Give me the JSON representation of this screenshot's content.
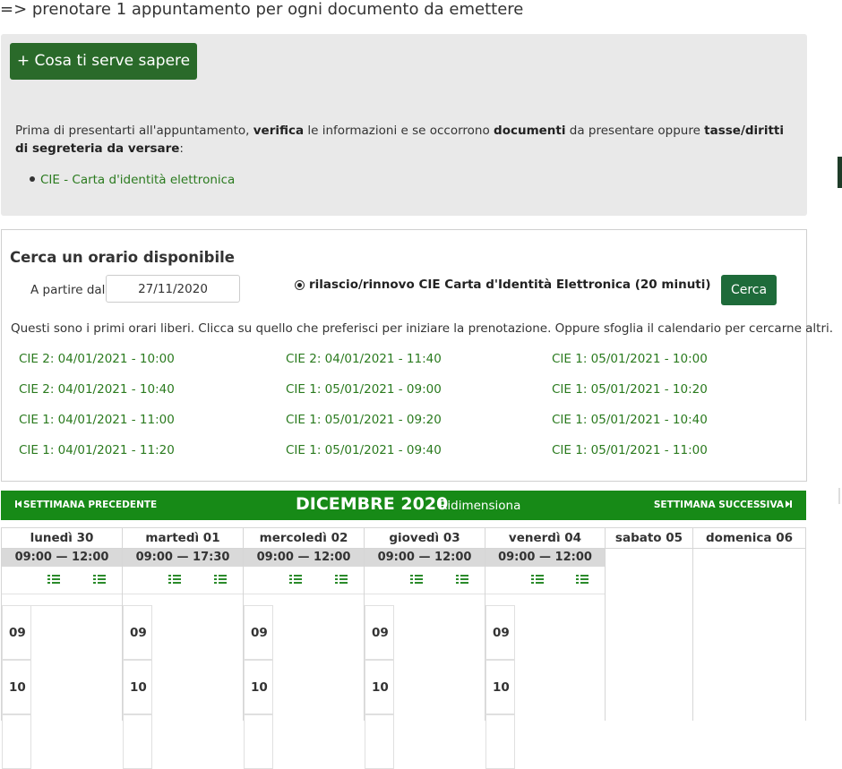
{
  "intro_line": "=> prenotare 1 appuntamento per ogni documento da emettere",
  "info": {
    "button_label": "+ Cosa ti serve sapere",
    "text_1": "Prima di presentarti all'appuntamento, ",
    "text_2": "verifica",
    "text_3": " le informazioni e se occorrono ",
    "text_4": "documenti",
    "text_5": " da presentare oppure ",
    "text_6": "tasse/diritti di segreteria da versare",
    "text_7": ":",
    "doc_link": "CIE - Carta d'identità elettronica"
  },
  "search": {
    "title": "Cerca un orario disponibile",
    "from_label": "A partire dal:",
    "date_value": "27/11/2020",
    "service_label": "rilascio/rinnovo CIE Carta d'Identità Elettronica (20 minuti)",
    "button_label": "Cerca",
    "hint": "Questi sono i primi orari liberi. Clicca su quello che preferisci per iniziare la prenotazione. Oppure sfoglia il calendario per cercarne altri.",
    "slots": [
      [
        "CIE 2: 04/01/2021 - 10:00",
        "CIE 2: 04/01/2021 - 10:40",
        "CIE 1: 04/01/2021 - 11:00",
        "CIE 1: 04/01/2021 - 11:20"
      ],
      [
        "CIE 2: 04/01/2021 - 11:40",
        "CIE 1: 05/01/2021 - 09:00",
        "CIE 1: 05/01/2021 - 09:20",
        "CIE 1: 05/01/2021 - 09:40"
      ],
      [
        "CIE 1: 05/01/2021 - 10:00",
        "CIE 1: 05/01/2021 - 10:20",
        "CIE 1: 05/01/2021 - 10:40",
        "CIE 1: 05/01/2021 - 11:00"
      ]
    ]
  },
  "calendar": {
    "prev_label": "SETTIMANA PRECEDENTE",
    "next_label": "SETTIMANA SUCCESSIVA",
    "month": "DICEMBRE 2020",
    "resize_label": "Ridimensiona",
    "days": [
      {
        "name": "lunedì 30",
        "hours": "09:00 — 12:00",
        "rows": [
          "09",
          "10"
        ]
      },
      {
        "name": "martedì 01",
        "hours": "09:00 — 17:30",
        "rows": [
          "09",
          "10"
        ]
      },
      {
        "name": "mercoledì 02",
        "hours": "09:00 — 12:00",
        "rows": [
          "09",
          "10"
        ]
      },
      {
        "name": "giovedì 03",
        "hours": "09:00 — 12:00",
        "rows": [
          "09",
          "10"
        ]
      },
      {
        "name": "venerdì 04",
        "hours": "09:00 — 12:00",
        "rows": [
          "09",
          "10"
        ]
      },
      {
        "name": "sabato 05",
        "hours": "",
        "rows": []
      },
      {
        "name": "domenica 06",
        "hours": "",
        "rows": []
      }
    ]
  },
  "colors": {
    "accent_green": "#178a17",
    "button_dark_green": "#2a6a2a",
    "link_green": "#2a7a1e"
  },
  "icons": [
    "list-icon",
    "radio-selected-icon",
    "first-page-icon",
    "last-page-icon"
  ]
}
